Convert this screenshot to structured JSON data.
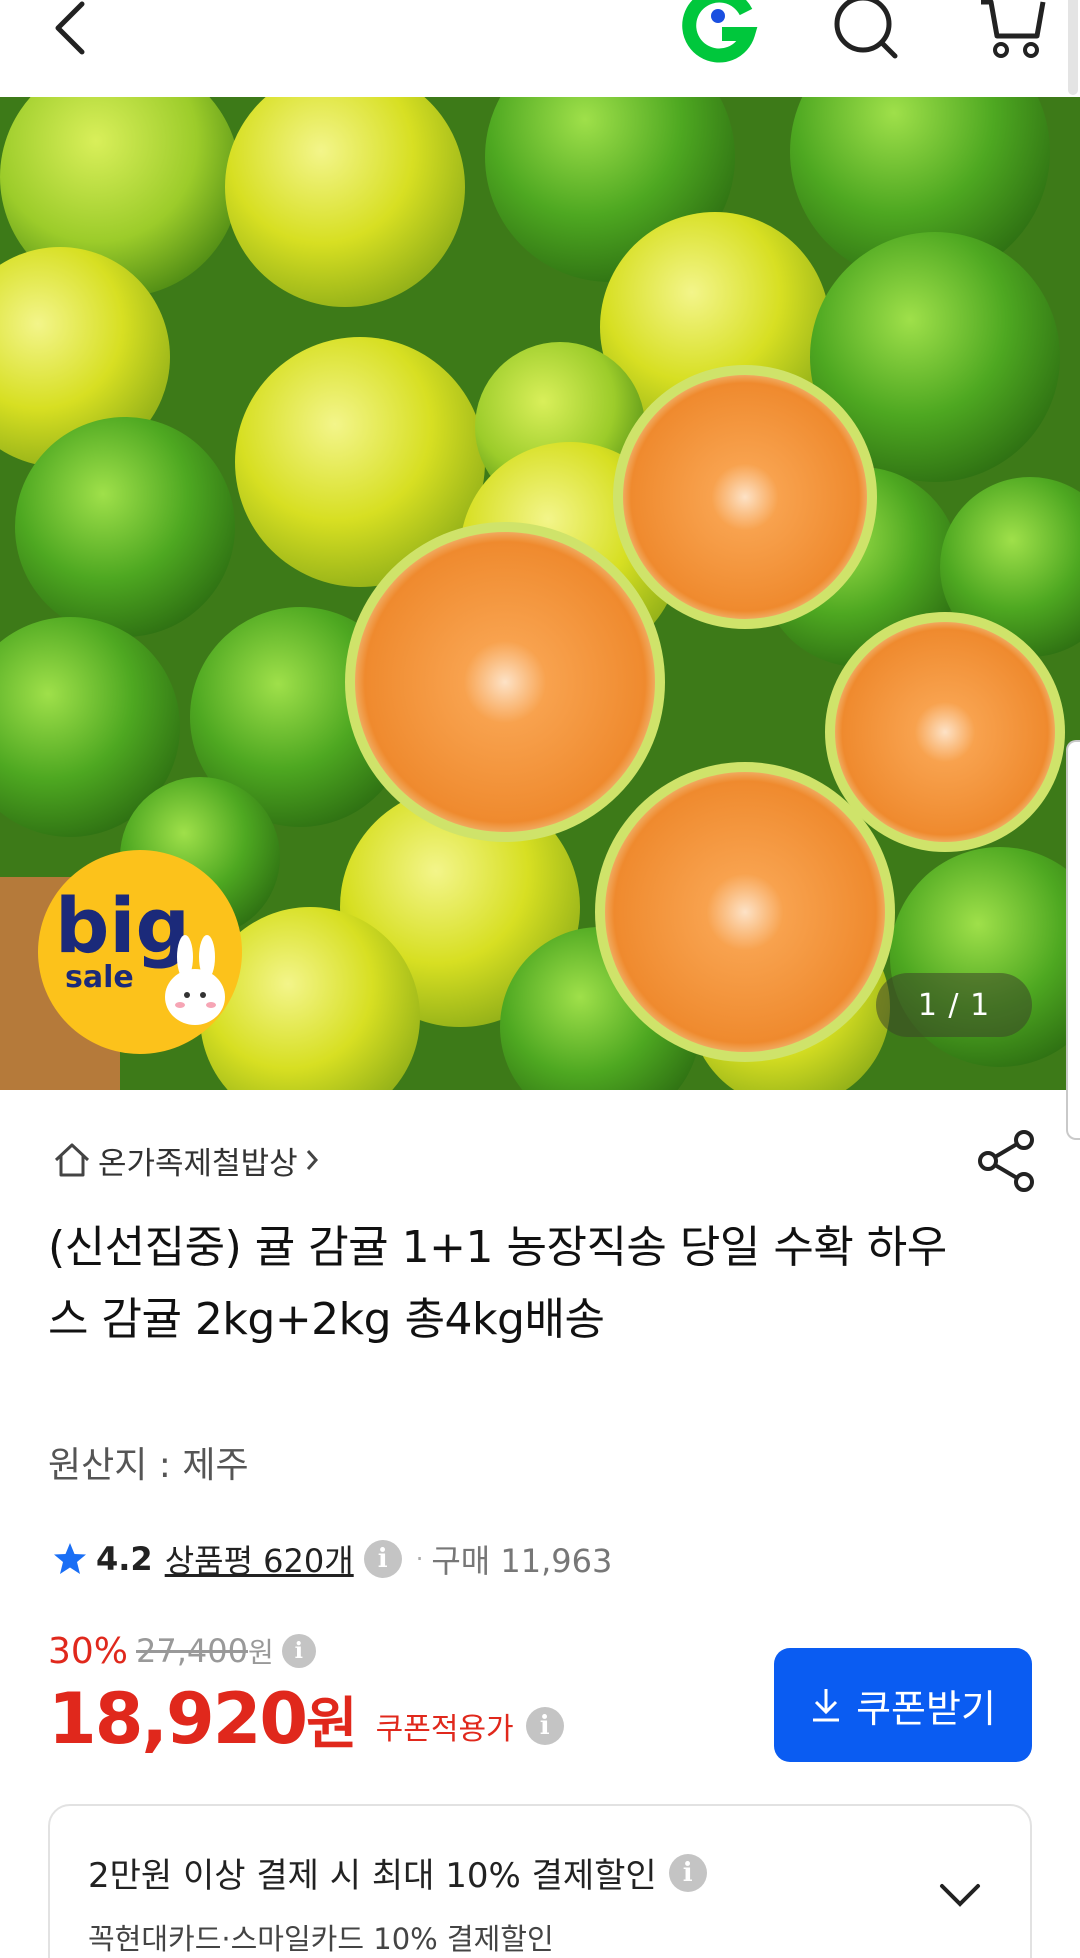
{
  "header": {
    "back_icon": "chevron-left-icon",
    "logo_icon": "g-logo-icon",
    "search_icon": "search-icon",
    "cart_icon": "cart-icon"
  },
  "hero": {
    "page_indicator": "1 / 1",
    "badge": {
      "big": "big",
      "sale": "sale"
    }
  },
  "store": {
    "name": "온가족제철밥상"
  },
  "product": {
    "title": "(신선집중) 귤 감귤 1+1 농장직송 당일 수확 하우스 감귤 2kg+2kg 총4kg배송",
    "origin": "원산지 : 제주"
  },
  "rating": {
    "score": "4.2",
    "reviews": "상품평 620개",
    "sold": "구매 11,963"
  },
  "price": {
    "discount_rate": "30%",
    "original": "27,400",
    "original_unit": "원",
    "final": "18,920",
    "final_unit": "원",
    "coupon_label": "쿠폰적용가",
    "coupon_button": "쿠폰받기"
  },
  "payment_discount": {
    "title": "2만원 이상 결제 시 최대 10% 결제할인",
    "subtitle": "꼭현대카드·스마일카드 10% 결제할인"
  },
  "colors": {
    "sale_red": "#e0281c",
    "coupon_blue": "#0a5cf2",
    "brand_green": "#00c73c"
  }
}
